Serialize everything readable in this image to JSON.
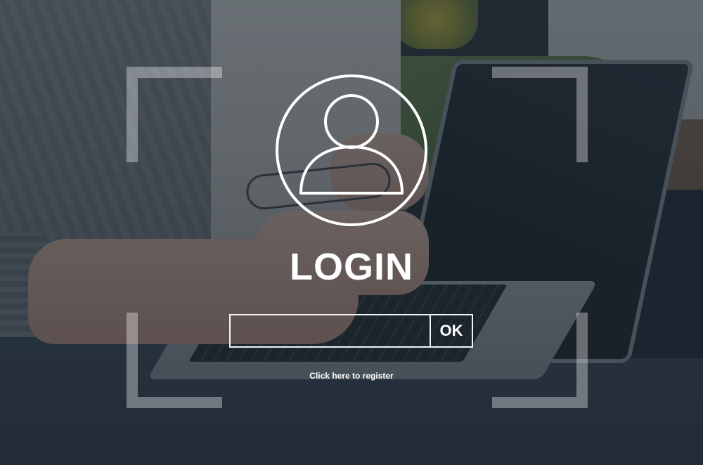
{
  "login": {
    "title": "LOGIN",
    "username_value": "",
    "ok_label": "OK",
    "register_link": "Click here to register"
  },
  "icons": {
    "user": "user-icon"
  },
  "colors": {
    "overlay": "#1c2632",
    "ui_foreground": "#ffffff"
  }
}
